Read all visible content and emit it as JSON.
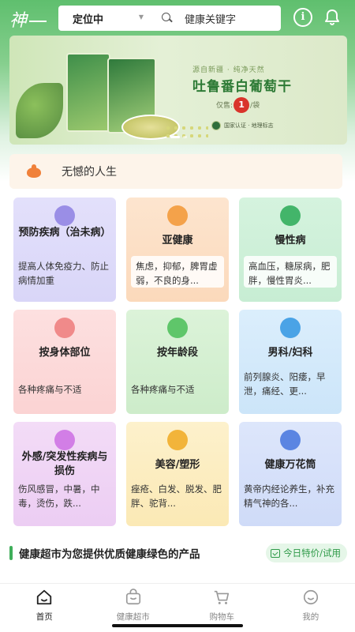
{
  "header": {
    "logo": "神",
    "location": "定位中",
    "search_placeholder": "健康关键字"
  },
  "banner": {
    "subtitle": "源自新疆 · 纯净天然",
    "title": "吐鲁番白葡萄干",
    "price_prefix": "仅售:",
    "price_value": "1",
    "price_suffix": "/袋",
    "cert": "国家认证 · 地理标志",
    "slide_count": 2,
    "active_slide": 1
  },
  "motto": {
    "text": "无憾的人生"
  },
  "categories": [
    {
      "title": "预防疾病（治未病）",
      "desc": "提高人体免疫力、防止病情加重",
      "icon": "tea-cup-icon",
      "color": "#9a8ee6"
    },
    {
      "title": "亚健康",
      "desc": "焦虑，抑郁，脾胃虚弱，不良的身...",
      "icon": "lungs-icon",
      "color": "#f4a24a"
    },
    {
      "title": "慢性病",
      "desc": "高血压，糖尿病，肥胖，慢性胃炎...",
      "icon": "virus-icon",
      "color": "#43b56a"
    },
    {
      "title": "按身体部位",
      "desc": "各种疼痛与不适",
      "icon": "body-part-icon",
      "color": "#f08a8a"
    },
    {
      "title": "按年龄段",
      "desc": "各种疼痛与不适",
      "icon": "age-badge-icon",
      "color": "#5fc66a"
    },
    {
      "title": "男科/妇科",
      "desc": "前列腺炎、阳痿，早泄，痛经、更...",
      "icon": "male-female-icon",
      "color": "#4aa3e6"
    },
    {
      "title": "外感/突发性疾病与损伤",
      "desc": "伤风感冒，中暑，中毒，烫伤，跌...",
      "icon": "injury-icon",
      "color": "#d27ee6"
    },
    {
      "title": "美容/塑形",
      "desc": "痤疮、白发、脱发、肥胖、驼背...",
      "icon": "body-shape-icon",
      "color": "#f2b43a"
    },
    {
      "title": "健康万花筒",
      "desc": "黄帝内经论养生，补充精气神的各...",
      "icon": "book-icon",
      "color": "#5b85e2"
    }
  ],
  "section": {
    "title": "健康超市为您提供优质健康绿色的产品",
    "special_label": "今日特价/试用"
  },
  "tabs": [
    {
      "label": "首页",
      "icon": "home-icon",
      "active": true
    },
    {
      "label": "健康超市",
      "icon": "shopping-bag-icon",
      "active": false
    },
    {
      "label": "购物车",
      "icon": "cart-icon",
      "active": false
    },
    {
      "label": "我的",
      "icon": "smile-profile-icon",
      "active": false
    }
  ]
}
